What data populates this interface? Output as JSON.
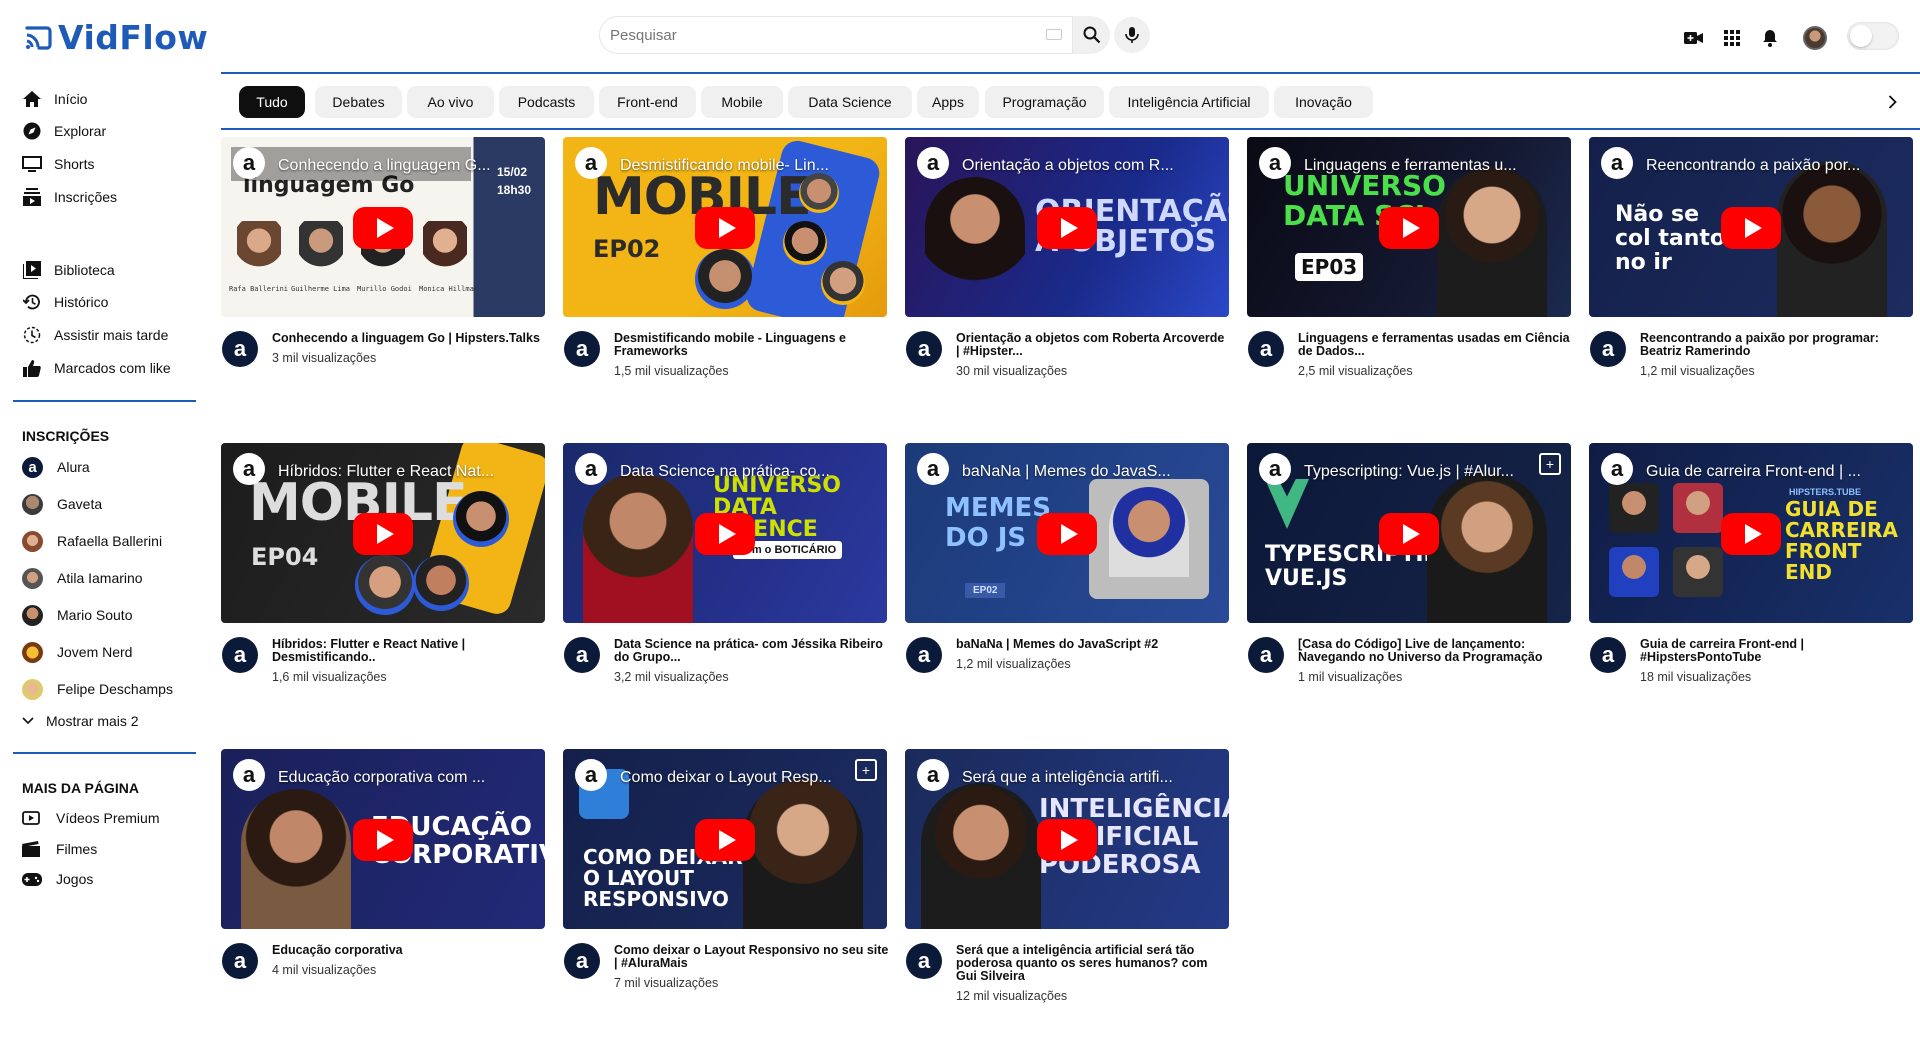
{
  "app": {
    "name": "VidFlow"
  },
  "search": {
    "placeholder": "Pesquisar"
  },
  "sidebar": {
    "main": [
      "Início",
      "Explorar",
      "Shorts",
      "Inscrições"
    ],
    "library": [
      "Biblioteca",
      "Histórico",
      "Assistir mais tarde",
      "Marcados com like"
    ],
    "subs_heading": "INSCRIÇÕES",
    "subs": [
      "Alura",
      "Gaveta",
      "Rafaella Ballerini",
      "Atila Iamarino",
      "Mario Souto",
      "Jovem Nerd",
      "Felipe Deschamps"
    ],
    "show_more": "Mostrar mais 2",
    "more_heading": "MAIS DA PÁGINA",
    "more": [
      "Vídeos Premium",
      "Filmes",
      "Jogos"
    ]
  },
  "chips": [
    "Tudo",
    "Debates",
    "Ao vivo",
    "Podcasts",
    "Front-end",
    "Mobile",
    "Data Science",
    "Apps",
    "Programação",
    "Inteligência Artificial",
    "Inovação"
  ],
  "videos": [
    {
      "thumb_title": "Conhecendo a linguagem G...",
      "title": "Conhecendo a linguagem Go | Hipsters.Talks",
      "views": "3 mil visualizações",
      "thumb_text": "linguagem Go",
      "thumb_date": "15/02",
      "thumb_time": "18h30",
      "names": [
        "Rafa Ballerini",
        "Guilherme Lima",
        "Murillo Godoi",
        "Monica Hillman"
      ]
    },
    {
      "thumb_title": "Desmistificando mobile- Lin...",
      "title": "Desmistificando mobile - Linguagens e Frameworks",
      "views": "1,5 mil visualizações",
      "thumb_text": "MOBILE",
      "thumb_sub": "EP02"
    },
    {
      "thumb_title": "Orientação a objetos com R...",
      "title": "Orientação a objetos com Roberta Arcoverde | #Hipster...",
      "views": "30 mil visualizações",
      "thumb_text": "ORIENTAÇÃO A OBJETOS"
    },
    {
      "thumb_title": "Linguagens e ferramentas u...",
      "title": "Linguagens e ferramentas usadas em Ciência de Dados...",
      "views": "2,5 mil visualizações",
      "thumb_text": "UNIVERSO DATA SCI",
      "thumb_sub": "EP03"
    },
    {
      "thumb_title": "Reencontrando a paixão por...",
      "title": "Reencontrando a paixão por programar: Beatriz Ramerindo",
      "views": "1,2 mil visualizações",
      "thumb_text": "Não se col tanto no ir"
    },
    {
      "thumb_title": "Híbridos: Flutter e React Nat...",
      "title": "Híbridos: Flutter e React Native | Desmistificando..",
      "views": "1,6 mil visualizações",
      "thumb_text": "MOBILE",
      "thumb_sub": "EP04"
    },
    {
      "thumb_title": "Data Science na prática- co...",
      "title": "Data Science na prática- com Jéssika Ribeiro do Grupo...",
      "views": "3,2 mil visualizações",
      "thumb_text": "UNIVERSO DATA SCIENCE",
      "thumb_sub": "com o BOTICÁRIO"
    },
    {
      "thumb_title": "baNaNa | Memes do JavaS...",
      "title": "baNaNa | Memes do JavaScript #2",
      "views": "1,2 mil visualizações",
      "thumb_text": "MEMES DO JS",
      "thumb_sub": "EP02"
    },
    {
      "thumb_title": "Typescripting: Vue.js | #Alur...",
      "title": "[Casa do Código] Live de lançamento: Navegando no Universo da Programação",
      "views": "1 mil visualizações",
      "thumb_text": "TYPESCRIPTING: VUE.JS"
    },
    {
      "thumb_title": "Guia de carreira Front-end | ...",
      "title": "Guia de carreira Front-end | #HipstersPontoTube",
      "views": "18 mil visualizações",
      "thumb_text": "GUIA DE CARREIRA FRONT END",
      "thumb_sub": "HIPSTERS.TUBE"
    },
    {
      "thumb_title": "Educação corporativa com ...",
      "title": "Educação corporativa",
      "views": "4 mil visualizações",
      "thumb_text": "EDUCAÇÃO CORPORATIVA"
    },
    {
      "thumb_title": "Como deixar o Layout Resp...",
      "title": "Como deixar o Layout Responsivo no seu site | #AluraMais",
      "views": "7 mil visualizações",
      "thumb_text": "COMO DEIXAR O LAYOUT RESPONSIVO"
    },
    {
      "thumb_title": "Será que a inteligência artifi...",
      "title": "Será que a inteligência artificial será tão poderosa quanto os seres humanos? com Gui Silveira",
      "views": "12 mil visualizações",
      "thumb_text": "INTELIGÊNCIA ARTIFICIAL PODEROSA"
    }
  ],
  "colors": {
    "brand": "#1e5bb8",
    "play": "#ff0000",
    "chip_active": "#0f0f0f",
    "chip": "#f0f0f0"
  }
}
